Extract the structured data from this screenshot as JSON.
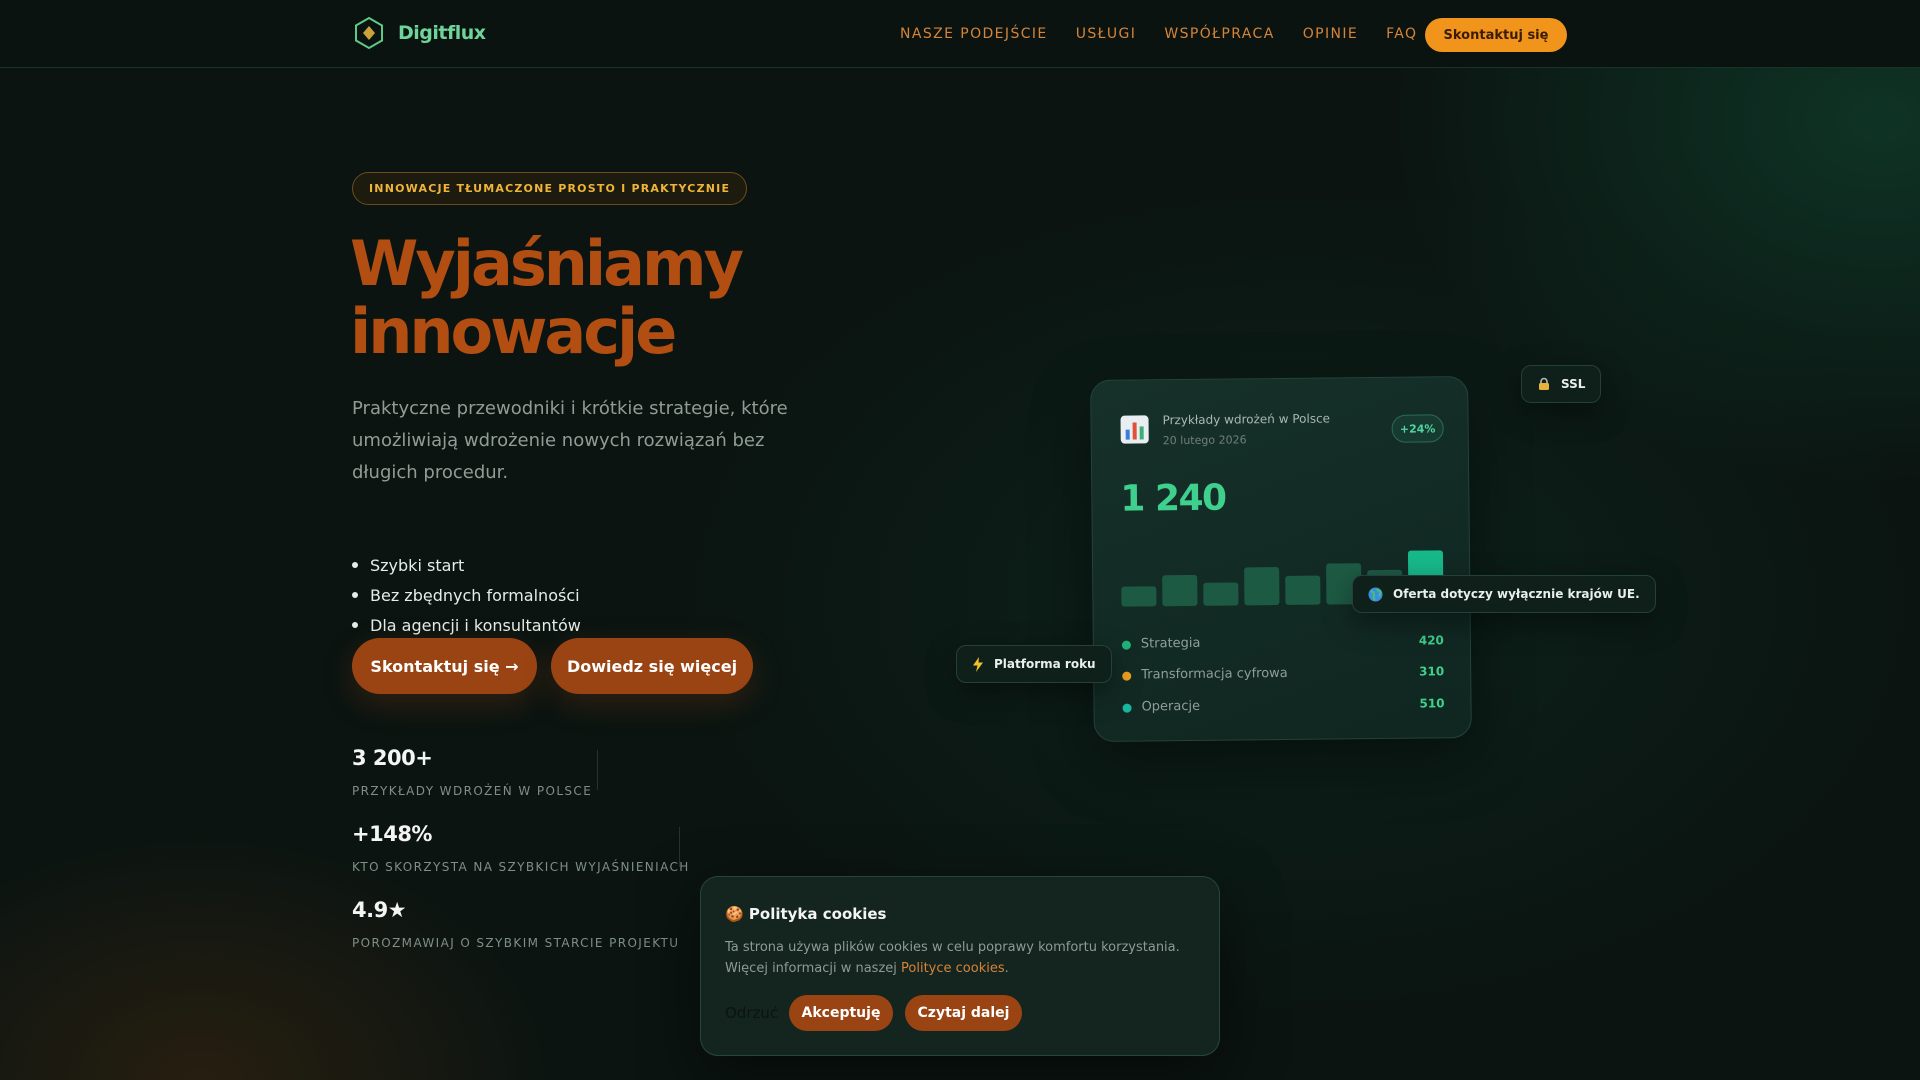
{
  "brand": {
    "name": "Digitflux",
    "logo_color": "#6fd39a"
  },
  "nav": {
    "items": [
      "NASZE PODEJŚCIE",
      "USŁUGI",
      "WSPÓŁPRACA",
      "OPINIE",
      "FAQ"
    ],
    "cta": "Skontaktuj się"
  },
  "hero": {
    "eyebrow": "INNOWACJE TŁUMACZONE PROSTO I PRAKTYCZNIE",
    "title_line1": "Wyjaśniamy",
    "title_line2": "innowacje",
    "lead": "Praktyczne przewodniki i krótkie strategie, które umożliwiają wdrożenie nowych rozwiązań bez długich procedur.",
    "bullets": [
      "Szybki start",
      "Bez zbędnych formalności",
      "Dla agencji i konsultantów"
    ],
    "primary_button": "Skontaktuj się →",
    "secondary_button": "Dowiedz się więcej"
  },
  "stats": [
    {
      "value": "3 200+",
      "label": "PRZYKŁADY WDROŻEŃ W POLSCE"
    },
    {
      "value": "+148%",
      "label": "KTO SKORZYSTA NA SZYBKICH WYJAŚNIENIACH"
    },
    {
      "value": "4.9★",
      "label": "POROZMAWIAJ O SZYBKIM STARCIE PROJEKTU"
    }
  ],
  "card": {
    "icon": "bar-chart-icon",
    "title": "Przykłady wdrożeń w Polsce",
    "date": "20 lutego 2026",
    "badge": "+24%",
    "big_number": "1 240",
    "bars": [
      0.3,
      0.46,
      0.34,
      0.56,
      0.42,
      0.6,
      0.5,
      0.78
    ],
    "rows": [
      {
        "label": "Strategia",
        "value": "420",
        "dot_color": "#22b07a"
      },
      {
        "label": "Transformacja cyfrowa",
        "value": "310",
        "dot_color": "#f0a020"
      },
      {
        "label": "Operacje",
        "value": "510",
        "dot_color": "#18b8a0"
      }
    ]
  },
  "chips": {
    "ssl": {
      "icon": "lock-icon",
      "text": "SSL"
    },
    "eu": {
      "icon": "globe-icon",
      "text": "Oferta dotyczy wyłącznie krajów UE."
    },
    "platform": {
      "icon": "lightning-icon",
      "text": "Platforma roku"
    }
  },
  "cookie": {
    "title": "🍪 Polityka cookies",
    "text": "Ta strona używa plików cookies w celu poprawy komfortu korzystania. Więcej informacji w naszej",
    "link": "Polityce cookies",
    "period": ".",
    "reject": "Odrzuć",
    "accept": "Akceptuję",
    "more": "Czytaj dalej"
  },
  "colors": {
    "background": "#0b1411",
    "accent_orange": "#f0941c",
    "button_brown": "#9b4413",
    "title_brown": "#b24e12",
    "green": "#3fd08e"
  }
}
